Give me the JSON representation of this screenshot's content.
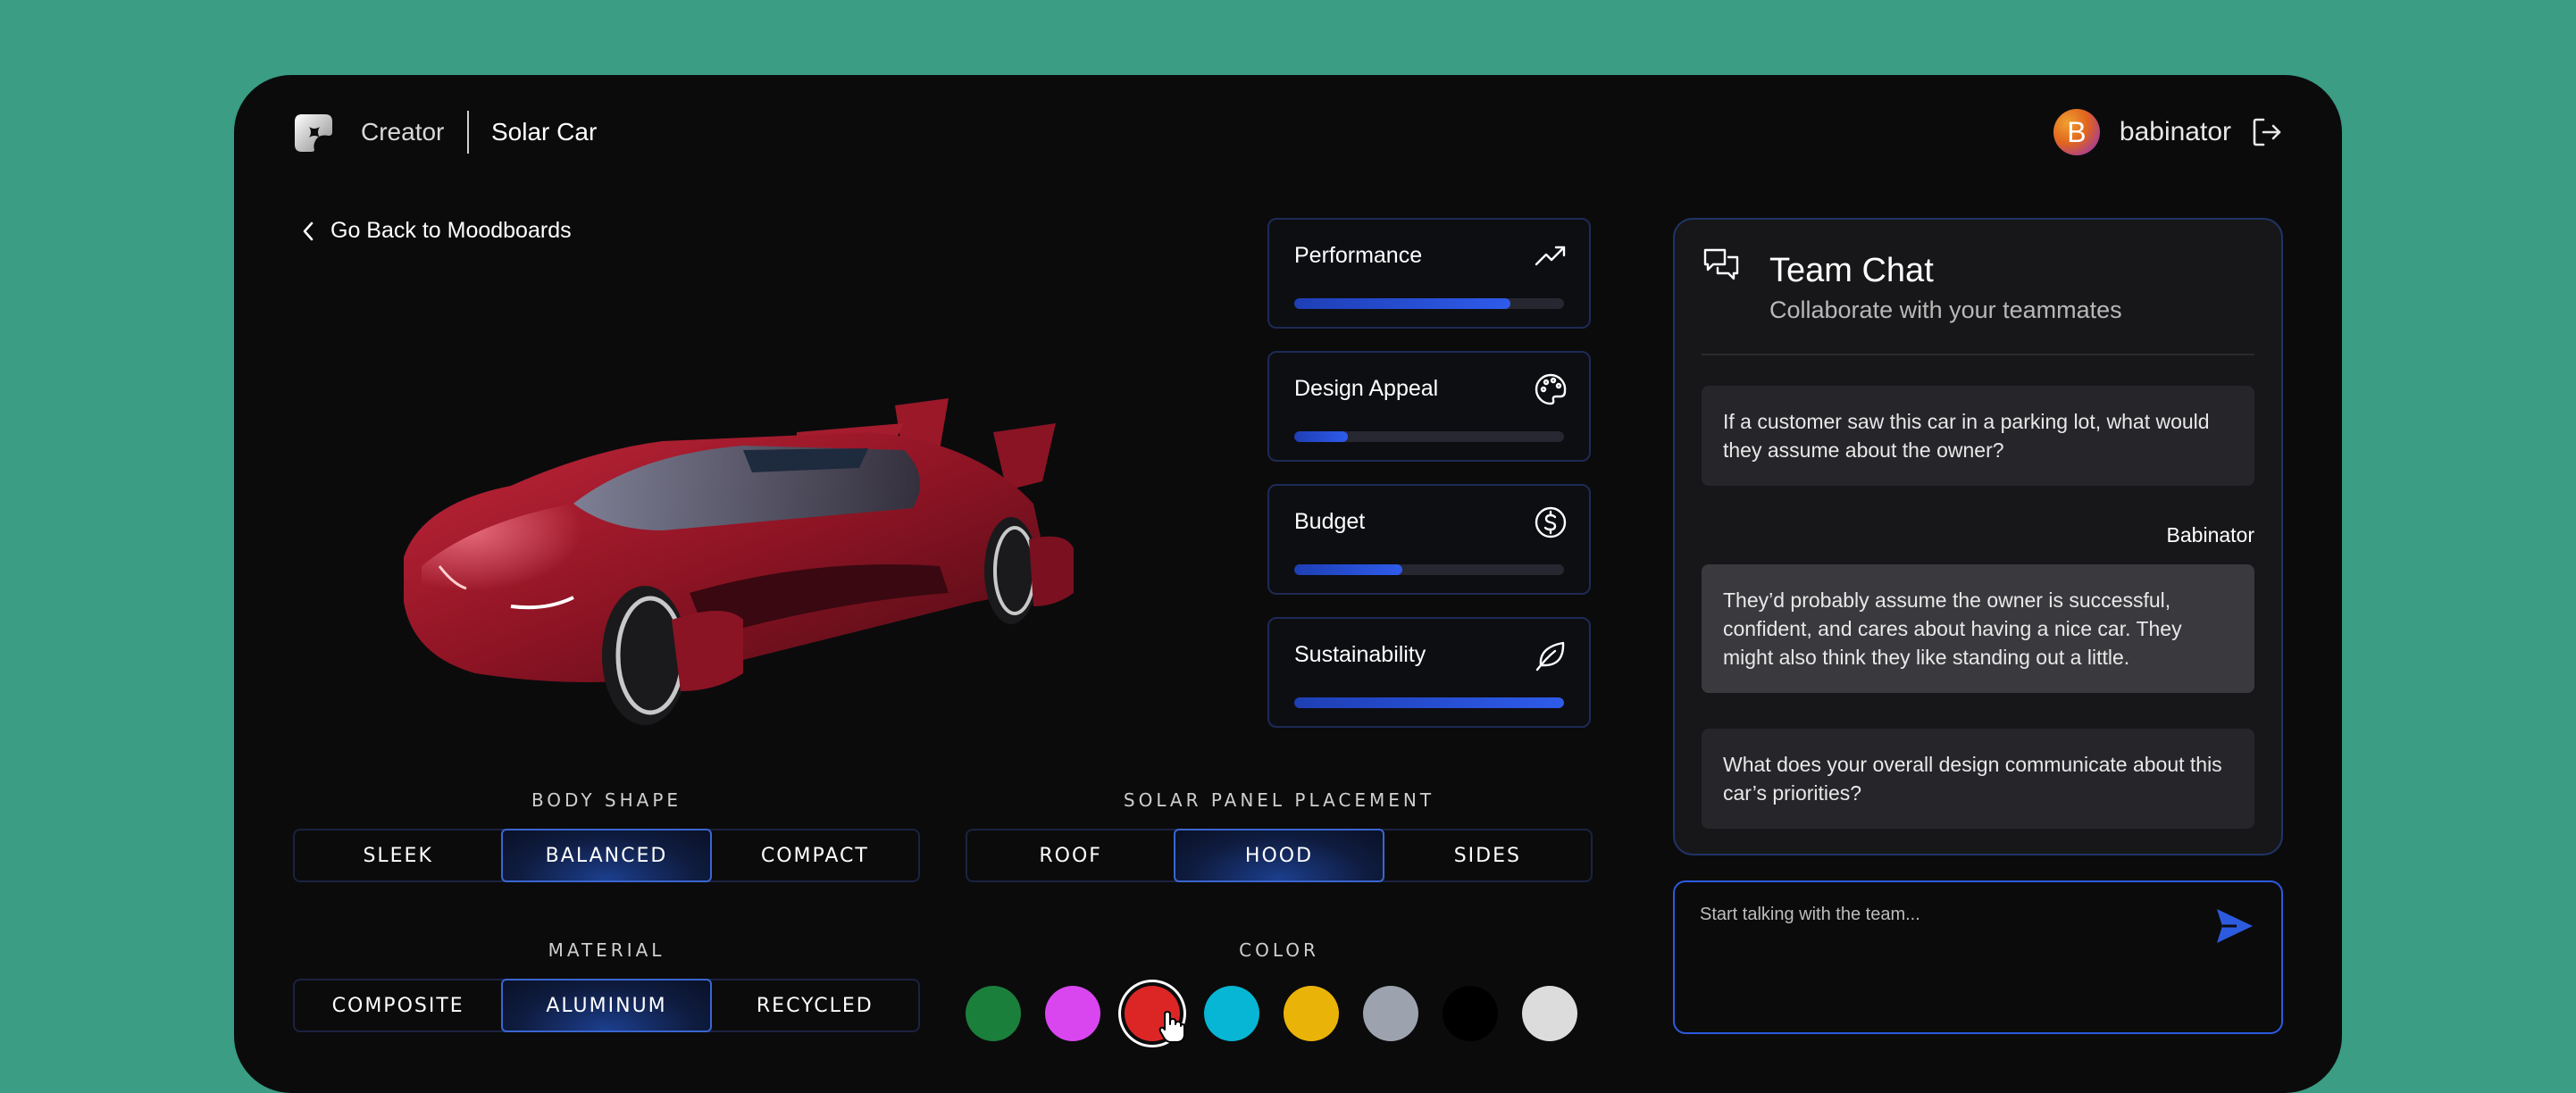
{
  "header": {
    "app_name": "Creator",
    "project_name": "Solar Car",
    "user": {
      "initial": "B",
      "name": "babinator"
    },
    "icons": {
      "logo": "creator-logo-icon",
      "logout": "logout-icon"
    }
  },
  "back_link": {
    "label": "Go Back to Moodboards",
    "icon": "chevron-left-icon"
  },
  "metrics": [
    {
      "label": "Performance",
      "icon": "trending-up-icon",
      "value": 0.8
    },
    {
      "label": "Design Appeal",
      "icon": "palette-icon",
      "value": 0.2
    },
    {
      "label": "Budget",
      "icon": "dollar-circle-icon",
      "value": 0.4
    },
    {
      "label": "Sustainability",
      "icon": "leaf-icon",
      "value": 1.0
    }
  ],
  "body_shape": {
    "label": "BODY SHAPE",
    "options": [
      "SLEEK",
      "BALANCED",
      "COMPACT"
    ],
    "selected": "BALANCED"
  },
  "solar_panel": {
    "label": "SOLAR PANEL PLACEMENT",
    "options": [
      "ROOF",
      "HOOD",
      "SIDES"
    ],
    "selected": "HOOD"
  },
  "material": {
    "label": "MATERIAL",
    "options": [
      "COMPOSITE",
      "ALUMINUM",
      "RECYCLED"
    ],
    "selected": "ALUMINUM"
  },
  "color": {
    "label": "COLOR",
    "swatches": [
      "#1b7f3c",
      "#d946ef",
      "#dc2626",
      "#06b6d4",
      "#eab308",
      "#9ca3af",
      "#000000",
      "#dcdcdc"
    ],
    "selected": "#dc2626"
  },
  "chat": {
    "title": "Team Chat",
    "subtitle": "Collaborate with your teammates",
    "icon": "chat-bubbles-icon",
    "messages": [
      {
        "text": "If a customer saw this car in a parking lot, what would they assume about the owner?"
      },
      {
        "sender": "Babinator",
        "text": "They’d probably assume the owner is successful, confident, and cares about having a nice car. They might also think they like standing out a little."
      },
      {
        "text": "What does your overall design communicate about this car’s priorities?"
      }
    ],
    "input_placeholder": "Start talking with the team...",
    "send_icon": "send-icon"
  },
  "colors": {
    "accent": "#2e5bea",
    "background": "#3a9d84",
    "panel": "#0b0b0c"
  }
}
